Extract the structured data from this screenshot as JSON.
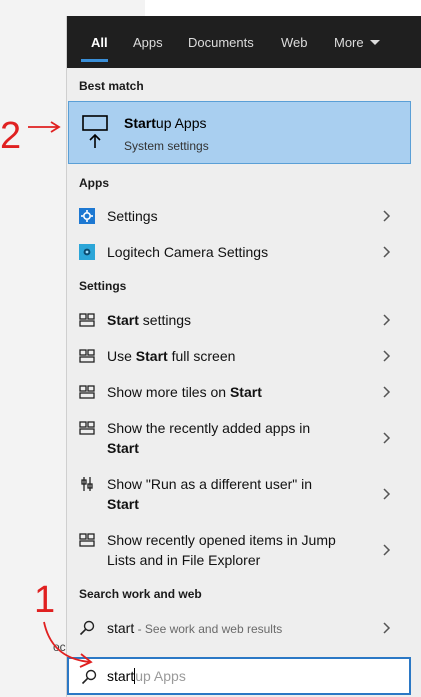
{
  "tabs": [
    "All",
    "Apps",
    "Documents",
    "Web",
    "More"
  ],
  "best_match_heading": "Best match",
  "best_match": {
    "title_bold": "Start",
    "title_rest": "up Apps",
    "subtitle": "System settings"
  },
  "apps_heading": "Apps",
  "apps": [
    {
      "label": "Settings",
      "icon": "gear-icon"
    },
    {
      "label": "Logitech Camera Settings",
      "icon": "logitech-camera-icon"
    }
  ],
  "settings_heading": "Settings",
  "settings_items": [
    {
      "line1_pre": "",
      "line1_bold": "Start",
      "line1_post": " settings",
      "line2_bold": "",
      "icon": "settings-tile-icon"
    },
    {
      "line1_pre": "Use ",
      "line1_bold": "Start",
      "line1_post": " full screen",
      "line2_bold": "",
      "icon": "settings-tile-icon"
    },
    {
      "line1_pre": "Show more tiles on ",
      "line1_bold": "Start",
      "line1_post": "",
      "line2_bold": "",
      "icon": "settings-tile-icon"
    },
    {
      "line1_pre": "Show the recently added apps in",
      "line1_bold": "",
      "line1_post": "",
      "line2_bold": "Start",
      "icon": "settings-tile-icon"
    },
    {
      "line1_pre": "Show \"Run as a different user\" in",
      "line1_bold": "",
      "line1_post": "",
      "line2_bold": "Start",
      "icon": "run-as-icon"
    },
    {
      "line1_pre": "Show recently opened items in Jump",
      "line1_bold": "",
      "line1_post": "",
      "line2_pre": "Lists and in File Explorer",
      "icon": "settings-tile-icon"
    }
  ],
  "search_web_heading": "Search work and web",
  "web_result": {
    "query": "start",
    "hint": " - See work and web results"
  },
  "search_box": {
    "typed": "start",
    "suggestion": "up Apps"
  },
  "annotations": {
    "one": "1",
    "two": "2"
  },
  "left_fragment": "oc",
  "colors": {
    "accent": "#2b78c5",
    "highlight": "#a9cff0",
    "annotation": "#e02020"
  }
}
